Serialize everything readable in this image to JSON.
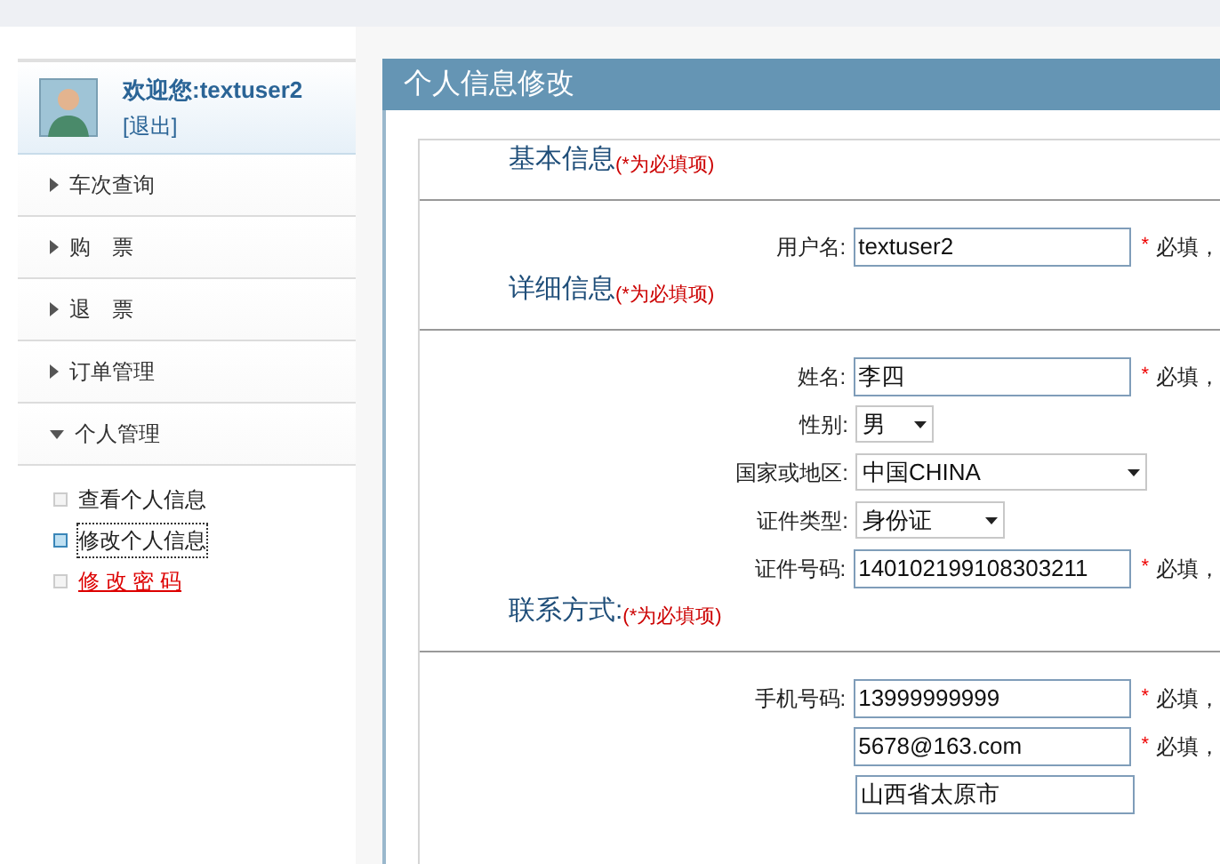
{
  "sidebar": {
    "user": {
      "greeting": "欢迎您:textuser2",
      "logout": "[退出]"
    },
    "menu": [
      {
        "label": "车次查询",
        "expanded": false
      },
      {
        "label": "购　票",
        "expanded": false
      },
      {
        "label": "退　票",
        "expanded": false
      },
      {
        "label": "订单管理",
        "expanded": false
      },
      {
        "label": "个人管理",
        "expanded": true,
        "children": [
          {
            "label": "查看个人信息",
            "kind": "item",
            "selected": false
          },
          {
            "label": "修改个人信息",
            "kind": "item",
            "selected": true
          },
          {
            "label": "修 改 密 码",
            "kind": "link",
            "selected": false
          }
        ]
      }
    ]
  },
  "main": {
    "title": "个人信息修改",
    "sections": [
      {
        "title": "基本信息",
        "note": "(*为必填项)",
        "fields": [
          {
            "label": "用户名:",
            "kind": "input",
            "value": "textuser2",
            "mark": "*",
            "note": "必填，"
          }
        ]
      },
      {
        "title": "详细信息",
        "note": "(*为必填项)",
        "fields": [
          {
            "label": "姓名:",
            "kind": "input",
            "value": "李四",
            "mark": "*",
            "note": "必填，"
          },
          {
            "label": "性别:",
            "kind": "select",
            "value": "男"
          },
          {
            "label": "国家或地区:",
            "kind": "select",
            "value": "中国CHINA"
          },
          {
            "label": "证件类型:",
            "kind": "select",
            "value": "身份证"
          },
          {
            "label": "证件号码:",
            "kind": "input",
            "value": "140102199108303211",
            "mark": "*",
            "note": "必填，"
          }
        ]
      },
      {
        "title": "联系方式:",
        "note": "(*为必填项)",
        "fields": [
          {
            "label": "手机号码:",
            "kind": "input",
            "value": "13999999999",
            "mark": "*",
            "note": "必填，"
          },
          {
            "kind": "input",
            "value": "5678@163.com",
            "mark": "*",
            "note": "必填，"
          },
          {
            "kind": "input",
            "value": "山西省太原市"
          }
        ]
      }
    ]
  }
}
